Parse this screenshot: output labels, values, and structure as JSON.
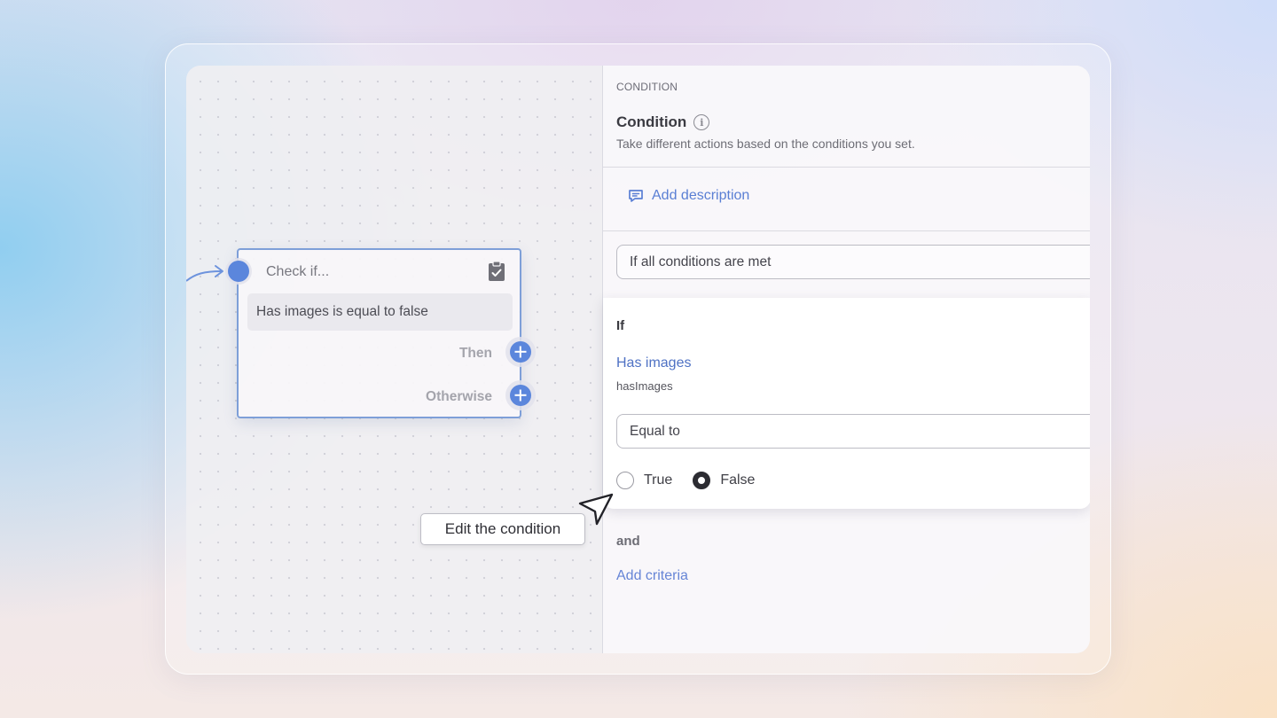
{
  "colors": {
    "accent": "#5b86dc",
    "link": "#5a7fd4",
    "node_border": "#7e9fd8"
  },
  "node": {
    "title": "Check if...",
    "condition_summary": "Has images is equal to false",
    "branches": [
      {
        "label": "Then"
      },
      {
        "label": "Otherwise"
      }
    ],
    "icon": "clipboard-check-icon"
  },
  "panel": {
    "section_tag": "CONDITION",
    "title": "Condition",
    "subtitle": "Take different actions based on the conditions you set.",
    "add_description": "Add description",
    "match_mode": "If all conditions are met",
    "criterion": {
      "heading": "If",
      "field_name": "Has images",
      "field_key": "hasImages",
      "operator": "Equal to",
      "options": [
        {
          "label": "True",
          "selected": false
        },
        {
          "label": "False",
          "selected": true
        }
      ]
    },
    "joiner": "and",
    "add_criteria": "Add criteria"
  },
  "tooltip": {
    "text": "Edit the condition"
  }
}
